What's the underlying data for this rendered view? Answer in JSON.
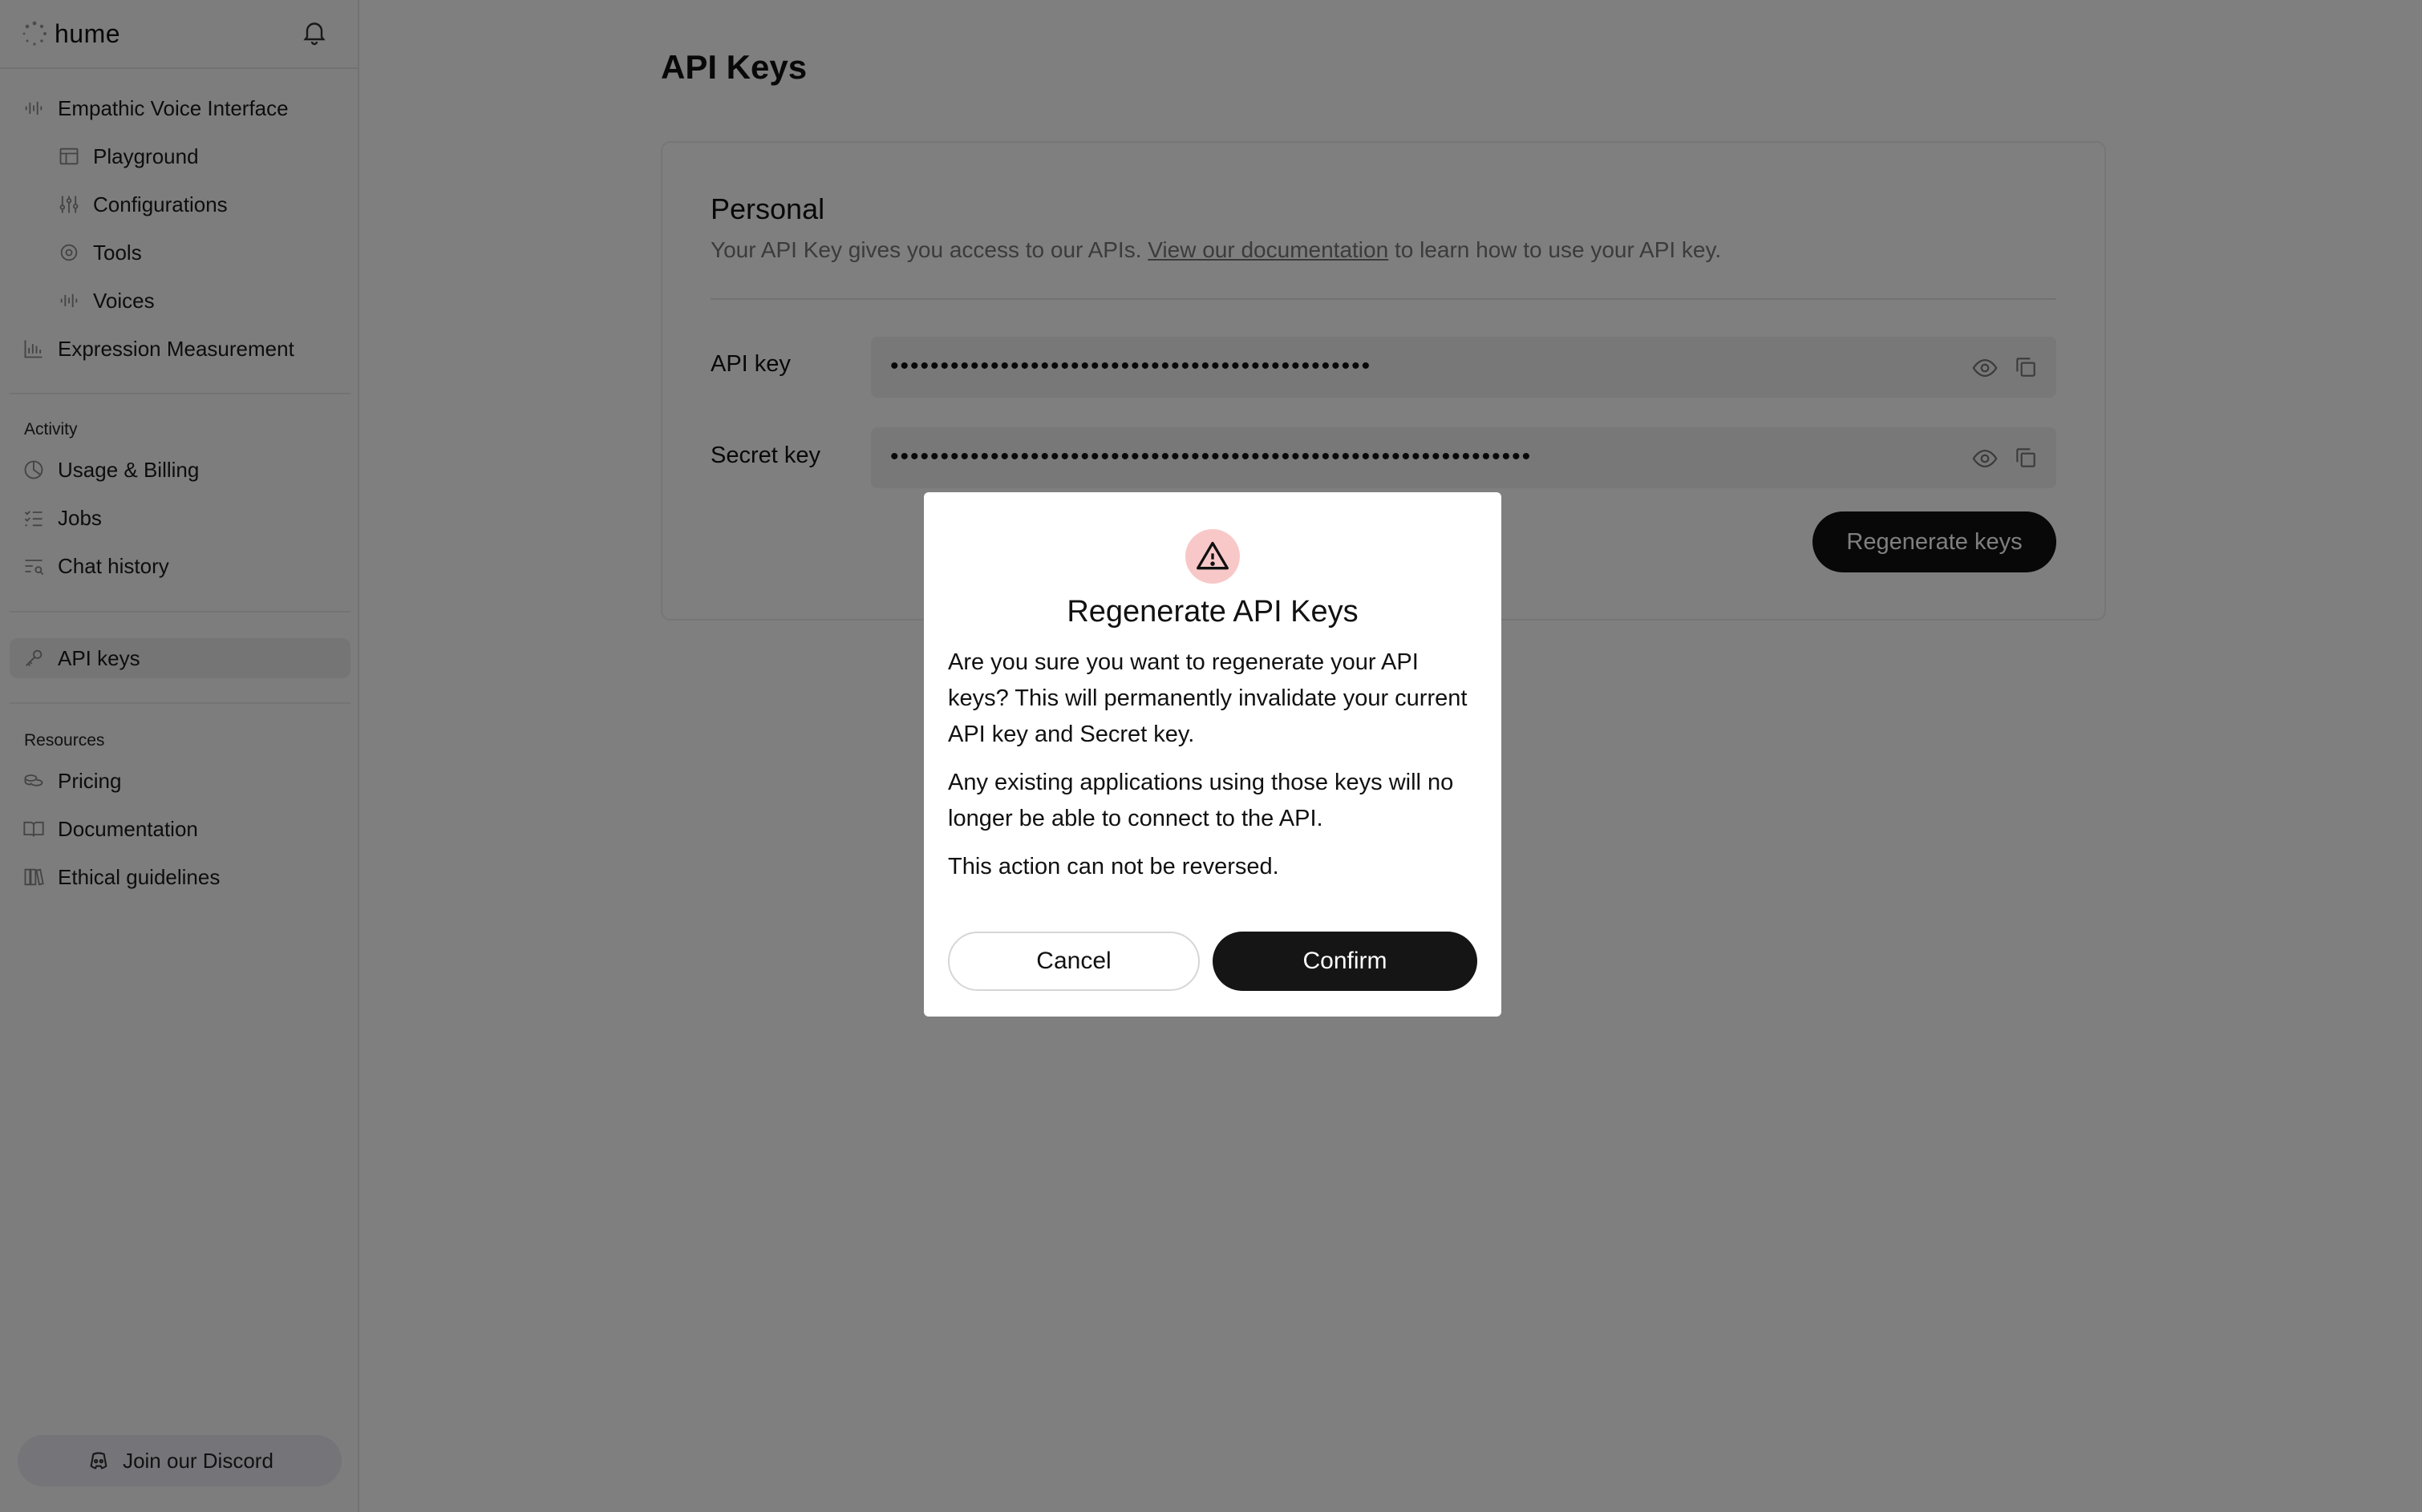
{
  "brand": {
    "name": "hume"
  },
  "sidebar": {
    "evi": {
      "label": "Empathic Voice Interface"
    },
    "evi_children": [
      {
        "label": "Playground"
      },
      {
        "label": "Configurations"
      },
      {
        "label": "Tools"
      },
      {
        "label": "Voices"
      }
    ],
    "expression": {
      "label": "Expression Measurement"
    },
    "activity_label": "Activity",
    "activity_items": [
      {
        "label": "Usage & Billing"
      },
      {
        "label": "Jobs"
      },
      {
        "label": "Chat history"
      }
    ],
    "api_keys": {
      "label": "API keys"
    },
    "resources_label": "Resources",
    "resource_items": [
      {
        "label": "Pricing"
      },
      {
        "label": "Documentation"
      },
      {
        "label": "Ethical guidelines"
      }
    ],
    "discord": {
      "label": "Join our Discord"
    }
  },
  "main": {
    "title": "API Keys",
    "card": {
      "title": "Personal",
      "desc_prefix": "Your API Key gives you access to our APIs. ",
      "desc_link": "View our documentation",
      "desc_suffix": " to learn how to use your API key.",
      "api_key_label": "API key",
      "api_key_value": "••••••••••••••••••••••••••••••••••••••••••••••••",
      "secret_key_label": "Secret key",
      "secret_key_value": "••••••••••••••••••••••••••••••••••••••••••••••••••••••••••••••••",
      "regenerate_label": "Regenerate keys"
    }
  },
  "modal": {
    "title": "Regenerate API Keys",
    "para1": "Are you sure you want to regenerate your API keys? This will permanently invalidate your current API key and Secret key.",
    "para2": "Any existing applications using those keys will no longer be able to connect to the API.",
    "para3": "This action can not be reversed.",
    "cancel_label": "Cancel",
    "confirm_label": "Confirm"
  },
  "colors": {
    "accent": "#111111",
    "warning_bg": "#f8c8c8",
    "overlay": "rgba(0,0,0,0.5)"
  }
}
